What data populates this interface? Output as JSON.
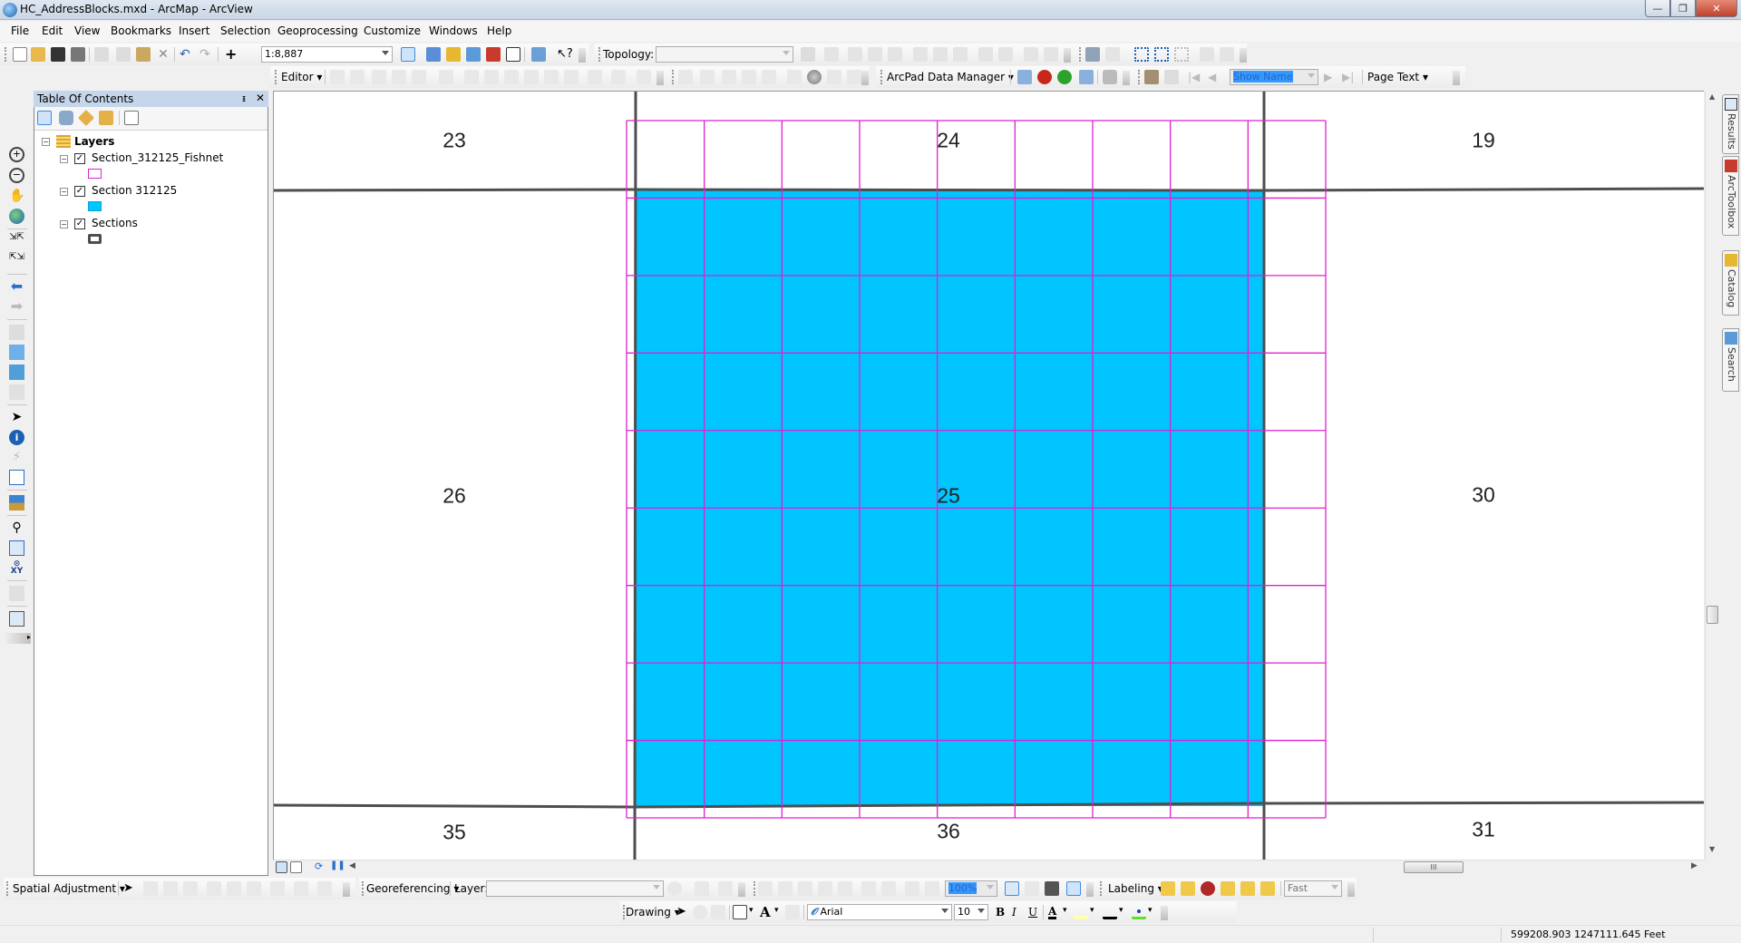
{
  "window": {
    "title": "HC_AddressBlocks.mxd - ArcMap - ArcView",
    "controls": {
      "minimize": "—",
      "maximize": "❐",
      "close": "✕"
    }
  },
  "menu": [
    "File",
    "Edit",
    "View",
    "Bookmarks",
    "Insert",
    "Selection",
    "Geoprocessing",
    "Customize",
    "Windows",
    "Help"
  ],
  "standard_toolbar": {
    "scale_value": "1:8,887",
    "icons": [
      "new-icon",
      "open-icon",
      "save-icon",
      "print-icon",
      "cut-icon",
      "copy-icon",
      "paste-icon",
      "delete-icon",
      "undo-icon",
      "redo-icon",
      "add-data-icon",
      "editor-toolbar-icon",
      "toc-icon",
      "catalog-icon",
      "search-icon",
      "arctoolbox-icon",
      "python-icon",
      "model-builder-icon",
      "whats-this-icon"
    ]
  },
  "topology_toolbar": {
    "label": "Topology:",
    "value": ""
  },
  "editor_toolbar": {
    "label": "Editor"
  },
  "arcpad_toolbar": {
    "label": "ArcPad Data Manager"
  },
  "page_toolbar": {
    "show_name_value": "Show Name",
    "page_text_label": "Page Text"
  },
  "toc": {
    "title": "Table Of Contents",
    "pin": "ᵻ",
    "close": "✕",
    "root": "Layers",
    "layers": [
      {
        "name": "Section_312125_Fishnet",
        "checked": true,
        "symbol": "outline-magenta",
        "color": "#e020d0"
      },
      {
        "name": "Section 312125",
        "checked": true,
        "symbol": "fill-cyan",
        "color": "#00c5ff"
      },
      {
        "name": "Sections",
        "checked": true,
        "symbol": "outline-dark-gray",
        "color": "#4e4e4e"
      }
    ]
  },
  "map": {
    "section_labels": [
      {
        "text": "23",
        "pos": "top-left"
      },
      {
        "text": "24",
        "pos": "top-center"
      },
      {
        "text": "19",
        "pos": "top-right"
      },
      {
        "text": "26",
        "pos": "middle-left"
      },
      {
        "text": "25",
        "pos": "center"
      },
      {
        "text": "30",
        "pos": "middle-right"
      },
      {
        "text": "35",
        "pos": "bottom-left"
      },
      {
        "text": "36",
        "pos": "bottom-center"
      },
      {
        "text": "31",
        "pos": "bottom-right"
      }
    ],
    "selected_section": "25",
    "fishnet_rows": 9,
    "fishnet_cols": 9,
    "colors": {
      "section_fill": "#00c5ff",
      "fishnet_line": "#e020d0",
      "section_line": "#4e4e4e"
    }
  },
  "map_view_buttons": {
    "data_view": "Data View",
    "layout_view": "Layout View",
    "refresh": "Refresh",
    "pause": "Pause Drawing"
  },
  "right_dock": [
    "Results",
    "ArcToolbox",
    "Catalog",
    "Search"
  ],
  "spatial_adjustment_toolbar": {
    "label": "Spatial Adjustment"
  },
  "georeferencing_toolbar": {
    "label": "Georeferencing",
    "layer_label": "Layer:",
    "layer_value": ""
  },
  "layout_toolbar": {
    "zoom_value": "100%"
  },
  "labeling_toolbar": {
    "label": "Labeling",
    "mode_value": "Fast"
  },
  "drawing_toolbar": {
    "label": "Drawing",
    "font_value": "Arial",
    "size_value": "10",
    "bold": "B",
    "italic": "I",
    "underline": "U",
    "font_color_glyph": "A"
  },
  "status": {
    "coordinates": "599208.903  1247111.645 Feet"
  }
}
